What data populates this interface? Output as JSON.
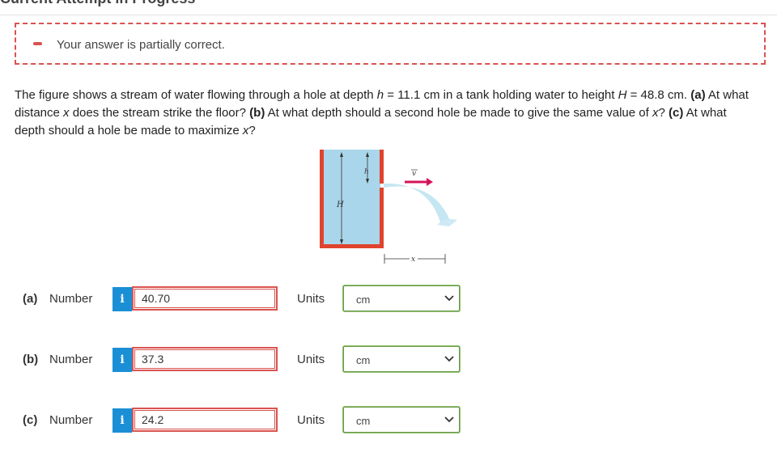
{
  "header": {
    "title": "Current Attempt in Progress"
  },
  "feedback": {
    "message": "Your answer is partially correct.",
    "color": "#d9534f"
  },
  "question": {
    "t1": "The figure shows a stream of water flowing through a hole at depth ",
    "h_sym": "h",
    "t2": " = 11.1 cm in a tank holding water to height ",
    "H_sym": "H",
    "t3": " = 48.8 cm. ",
    "a_tag": "(a)",
    "t4": " At what distance ",
    "x_sym1": "x",
    "t5": " does the stream strike the floor? ",
    "b_tag": "(b)",
    "t6": " At what depth should a second hole be made to give the same value of ",
    "x_sym2": "x",
    "t7": "? ",
    "c_tag": "(c)",
    "t8": " At what depth should a hole be made to maximize ",
    "x_sym3": "x",
    "t9": "?"
  },
  "figure": {
    "label_h": "h",
    "label_H": "H",
    "label_x": "x",
    "label_v": "v",
    "water_color": "#a9d6ea",
    "tank_color": "#e0432e",
    "arrow_color": "#d6145a"
  },
  "answers": [
    {
      "part": "(a)",
      "number_label": "Number",
      "info": "i",
      "value": "40.70",
      "units_label": "Units",
      "unit": "cm"
    },
    {
      "part": "(b)",
      "number_label": "Number",
      "info": "i",
      "value": "37.3",
      "units_label": "Units",
      "unit": "cm"
    },
    {
      "part": "(c)",
      "number_label": "Number",
      "info": "i",
      "value": "24.2",
      "units_label": "Units",
      "unit": "cm"
    }
  ]
}
